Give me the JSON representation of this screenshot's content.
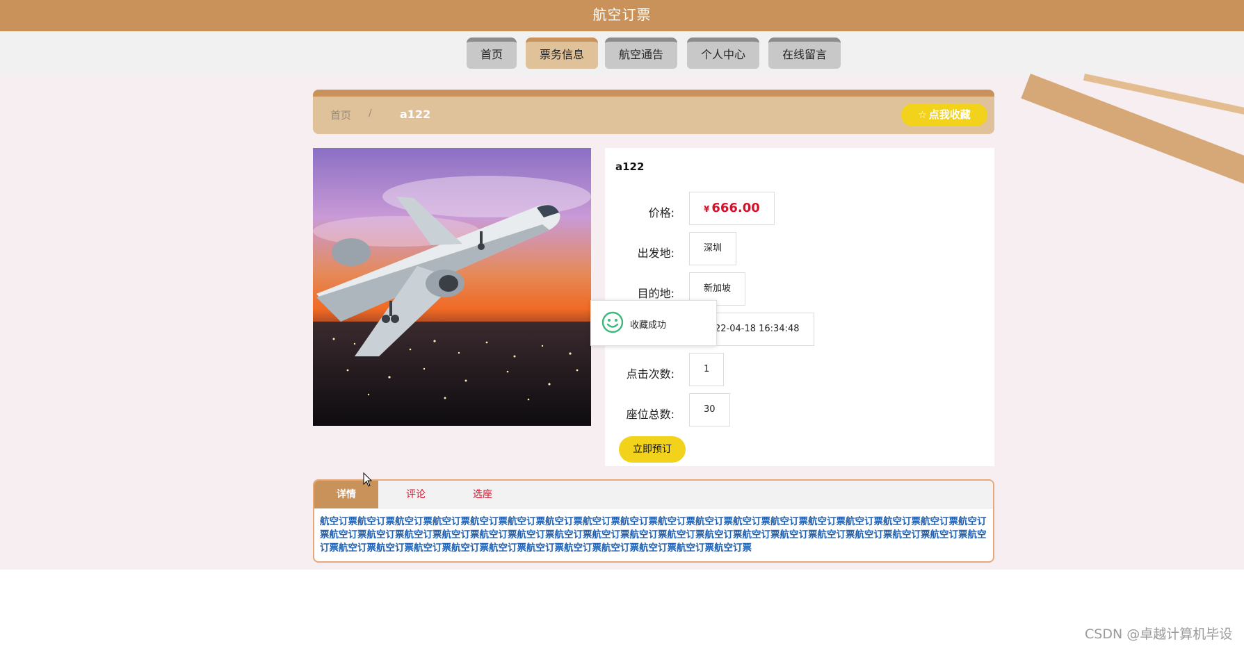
{
  "app": {
    "title": "航空订票"
  },
  "nav": {
    "items": [
      {
        "label": "首页"
      },
      {
        "label": "票务信息"
      },
      {
        "label": "航空通告"
      },
      {
        "label": "个人中心"
      },
      {
        "label": "在线留言"
      }
    ],
    "active_index": 1
  },
  "breadcrumb": {
    "home": "首页",
    "separator": "/",
    "current": "a122"
  },
  "favorite_button": {
    "icon": "star-outline-icon",
    "label": "点我收藏"
  },
  "ticket": {
    "title": "a122",
    "fields": [
      {
        "label": "价格:",
        "currency": "¥",
        "value": "666.00"
      },
      {
        "label": "出发地:",
        "value": "深圳"
      },
      {
        "label": "目的地:",
        "value": "新加坡"
      },
      {
        "label": "",
        "value": "22-04-18 16:34:48"
      },
      {
        "label": "点击次数:",
        "value": "1"
      },
      {
        "label": "座位总数:",
        "value": "30"
      }
    ],
    "book_label": "立即预订"
  },
  "toast": {
    "icon": "smile-icon",
    "message": "收藏成功"
  },
  "detail_tabs": {
    "tabs": [
      {
        "label": "详情"
      },
      {
        "label": "评论"
      },
      {
        "label": "选座"
      }
    ],
    "active_index": 0,
    "content": "航空订票航空订票航空订票航空订票航空订票航空订票航空订票航空订票航空订票航空订票航空订票航空订票航空订票航空订票航空订票航空订票航空订票航空订票航空订票航空订票航空订票航空订票航空订票航空订票航空订票航空订票航空订票航空订票航空订票航空订票航空订票航空订票航空订票航空订票航空订票航空订票航空订票航空订票航空订票航空订票航空订票航空订票航空订票航空订票航空订票航空订票航空订票"
  },
  "watermark": "CSDN @卓越计算机毕设",
  "colors": {
    "brand": "#c8925a",
    "accent_yellow": "#f2d21a",
    "price_red": "#d5122c",
    "link_blue": "#1f5fb0"
  }
}
